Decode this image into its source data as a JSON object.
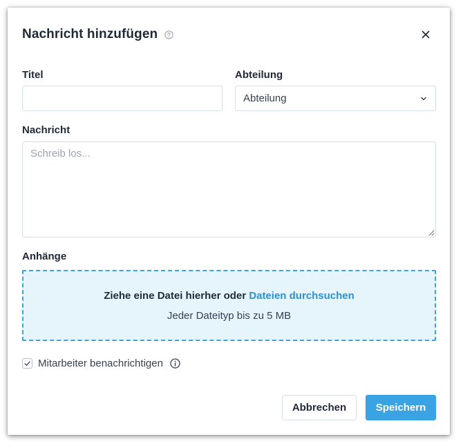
{
  "dialog": {
    "title": "Nachricht hinzufügen",
    "help_icon": "question-circle-icon",
    "close_icon": "close-icon",
    "close_glyph": "×"
  },
  "form": {
    "title_label": "Titel",
    "title_value": "",
    "department_label": "Abteilung",
    "department_selected": "Abteilung",
    "message_label": "Nachricht",
    "message_placeholder": "Schreib los...",
    "attachments_label": "Anhänge"
  },
  "dropzone": {
    "prompt": "Ziehe eine Datei hierher oder ",
    "browse_link": "Dateien durchsuchen",
    "hint": "Jeder Dateityp bis zu 5 MB"
  },
  "notify": {
    "checked": true,
    "label": "Mitarbeiter benachrichtigen",
    "info_icon": "info-circle-icon"
  },
  "actions": {
    "cancel_label": "Abbrechen",
    "save_label": "Speichern"
  },
  "colors": {
    "primary": "#3aa3e3",
    "link": "#2e8fd3",
    "dropzone_bg": "#e6f4fb",
    "border": "#d8dde3"
  }
}
